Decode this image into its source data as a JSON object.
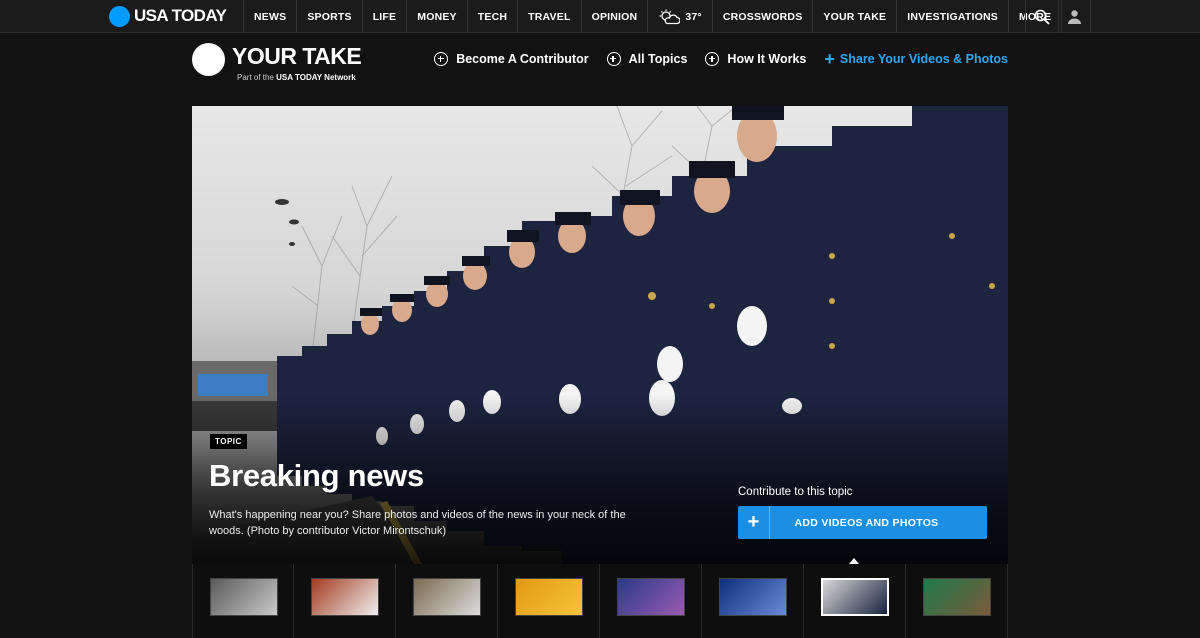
{
  "topnav": {
    "brand": "USA TODAY",
    "items": [
      "NEWS",
      "SPORTS",
      "LIFE",
      "MONEY",
      "TECH",
      "TRAVEL",
      "OPINION"
    ],
    "weather_temp": "37°",
    "items2": [
      "CROSSWORDS",
      "YOUR TAKE",
      "INVESTIGATIONS",
      "MORE"
    ],
    "icons": [
      "search-icon",
      "user-icon"
    ]
  },
  "yourtake": {
    "title": "YOUR TAKE",
    "sub_prefix": "Part of the",
    "sub_bold": "USA TODAY Network",
    "links": [
      "Become A Contributor",
      "All Topics",
      "How It Works"
    ],
    "share": "Share Your Videos & Photos"
  },
  "hero": {
    "badge": "TOPIC",
    "title": "Breaking news",
    "description": "What's happening near you? Share photos and videos of the news in your neck of the woods. (Photo by contributor Victor Mirontschuk)",
    "contribute_label": "Contribute to this topic",
    "button": "ADD VIDEOS AND PHOTOS"
  },
  "colors": {
    "accent": "#1a8fe3",
    "brand_blue": "#009bff",
    "link_blue": "#2fa8f0"
  },
  "thumbnails": [
    {
      "colors": [
        "#5a5a5a",
        "#c9c9c9"
      ],
      "active": false
    },
    {
      "colors": [
        "#a23a1f",
        "#f0f0f0"
      ],
      "active": false
    },
    {
      "colors": [
        "#7a6a4f",
        "#dcdcdc"
      ],
      "active": false
    },
    {
      "colors": [
        "#e29a12",
        "#f5c43a"
      ],
      "active": false
    },
    {
      "colors": [
        "#2b3a8a",
        "#9a5ab0"
      ],
      "active": false
    },
    {
      "colors": [
        "#0e2f7a",
        "#6a8ad8"
      ],
      "active": false
    },
    {
      "colors": [
        "#d8d8d8",
        "#1a2440"
      ],
      "active": true
    },
    {
      "colors": [
        "#1f7a4a",
        "#7a5a3a"
      ],
      "active": false
    }
  ]
}
